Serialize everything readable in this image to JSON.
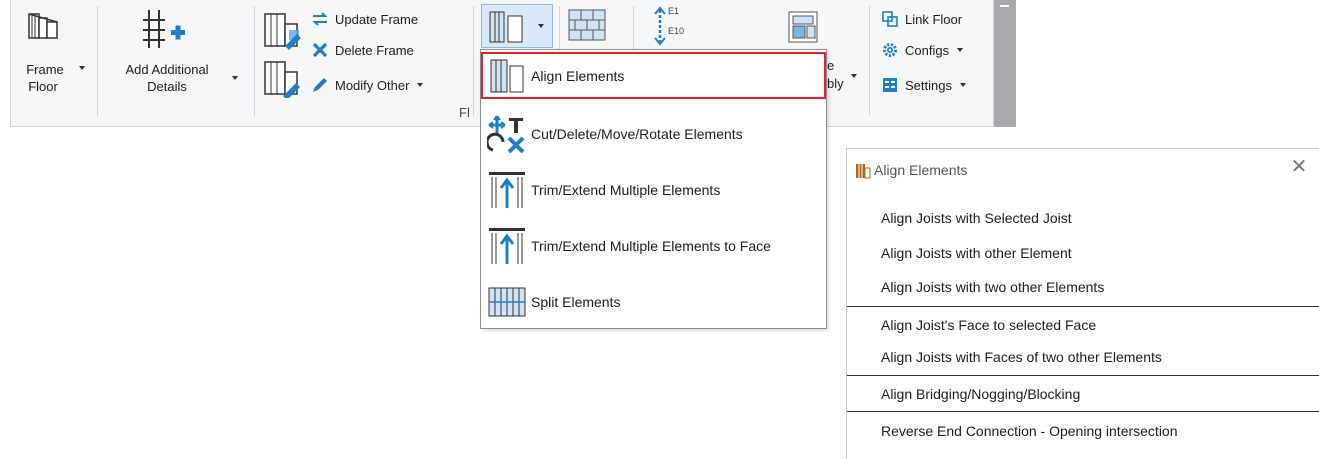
{
  "ribbon": {
    "frame_floor": [
      "Frame",
      "Floor"
    ],
    "add_details": [
      "Add Additional",
      "Details"
    ],
    "update_frame": "Update Frame",
    "delete_frame": "Delete Frame",
    "modify_other": "Modify Other",
    "panel_label_fragment": "Fl",
    "e1_label": "E1",
    "e10_label": "E10",
    "assembly_fragment_1": "e",
    "assembly_fragment_2": "bly",
    "link_floor": "Link Floor",
    "configs": "Configs",
    "settings": "Settings"
  },
  "dropdown": {
    "items": [
      {
        "label": "Align Elements",
        "icon": "align-elements-icon",
        "highlighted": true
      },
      {
        "label": "Cut/Delete/Move/Rotate Elements",
        "icon": "cut-move-rotate-icon"
      },
      {
        "label": "Trim/Extend Multiple Elements",
        "icon": "trim-extend-icon"
      },
      {
        "label": "Trim/Extend Multiple Elements to Face",
        "icon": "trim-extend-face-icon"
      },
      {
        "label": "Split Elements",
        "icon": "split-elements-icon"
      }
    ]
  },
  "panel": {
    "title": "Align Elements",
    "close_glyph": "✕",
    "items": [
      "Align Joists with Selected Joist",
      "Align Joists with other Element",
      "Align Joists with two other Elements",
      "Align Joist's Face to selected Face",
      "Align Joists with Faces of two other Elements",
      "Align Bridging/Nogging/Blocking",
      "Reverse End Connection - Opening intersection"
    ]
  },
  "colors": {
    "accent_blue": "#1e7ec8",
    "highlight_red": "#e0252c",
    "ribbon_bg": "#f5f6f7"
  }
}
